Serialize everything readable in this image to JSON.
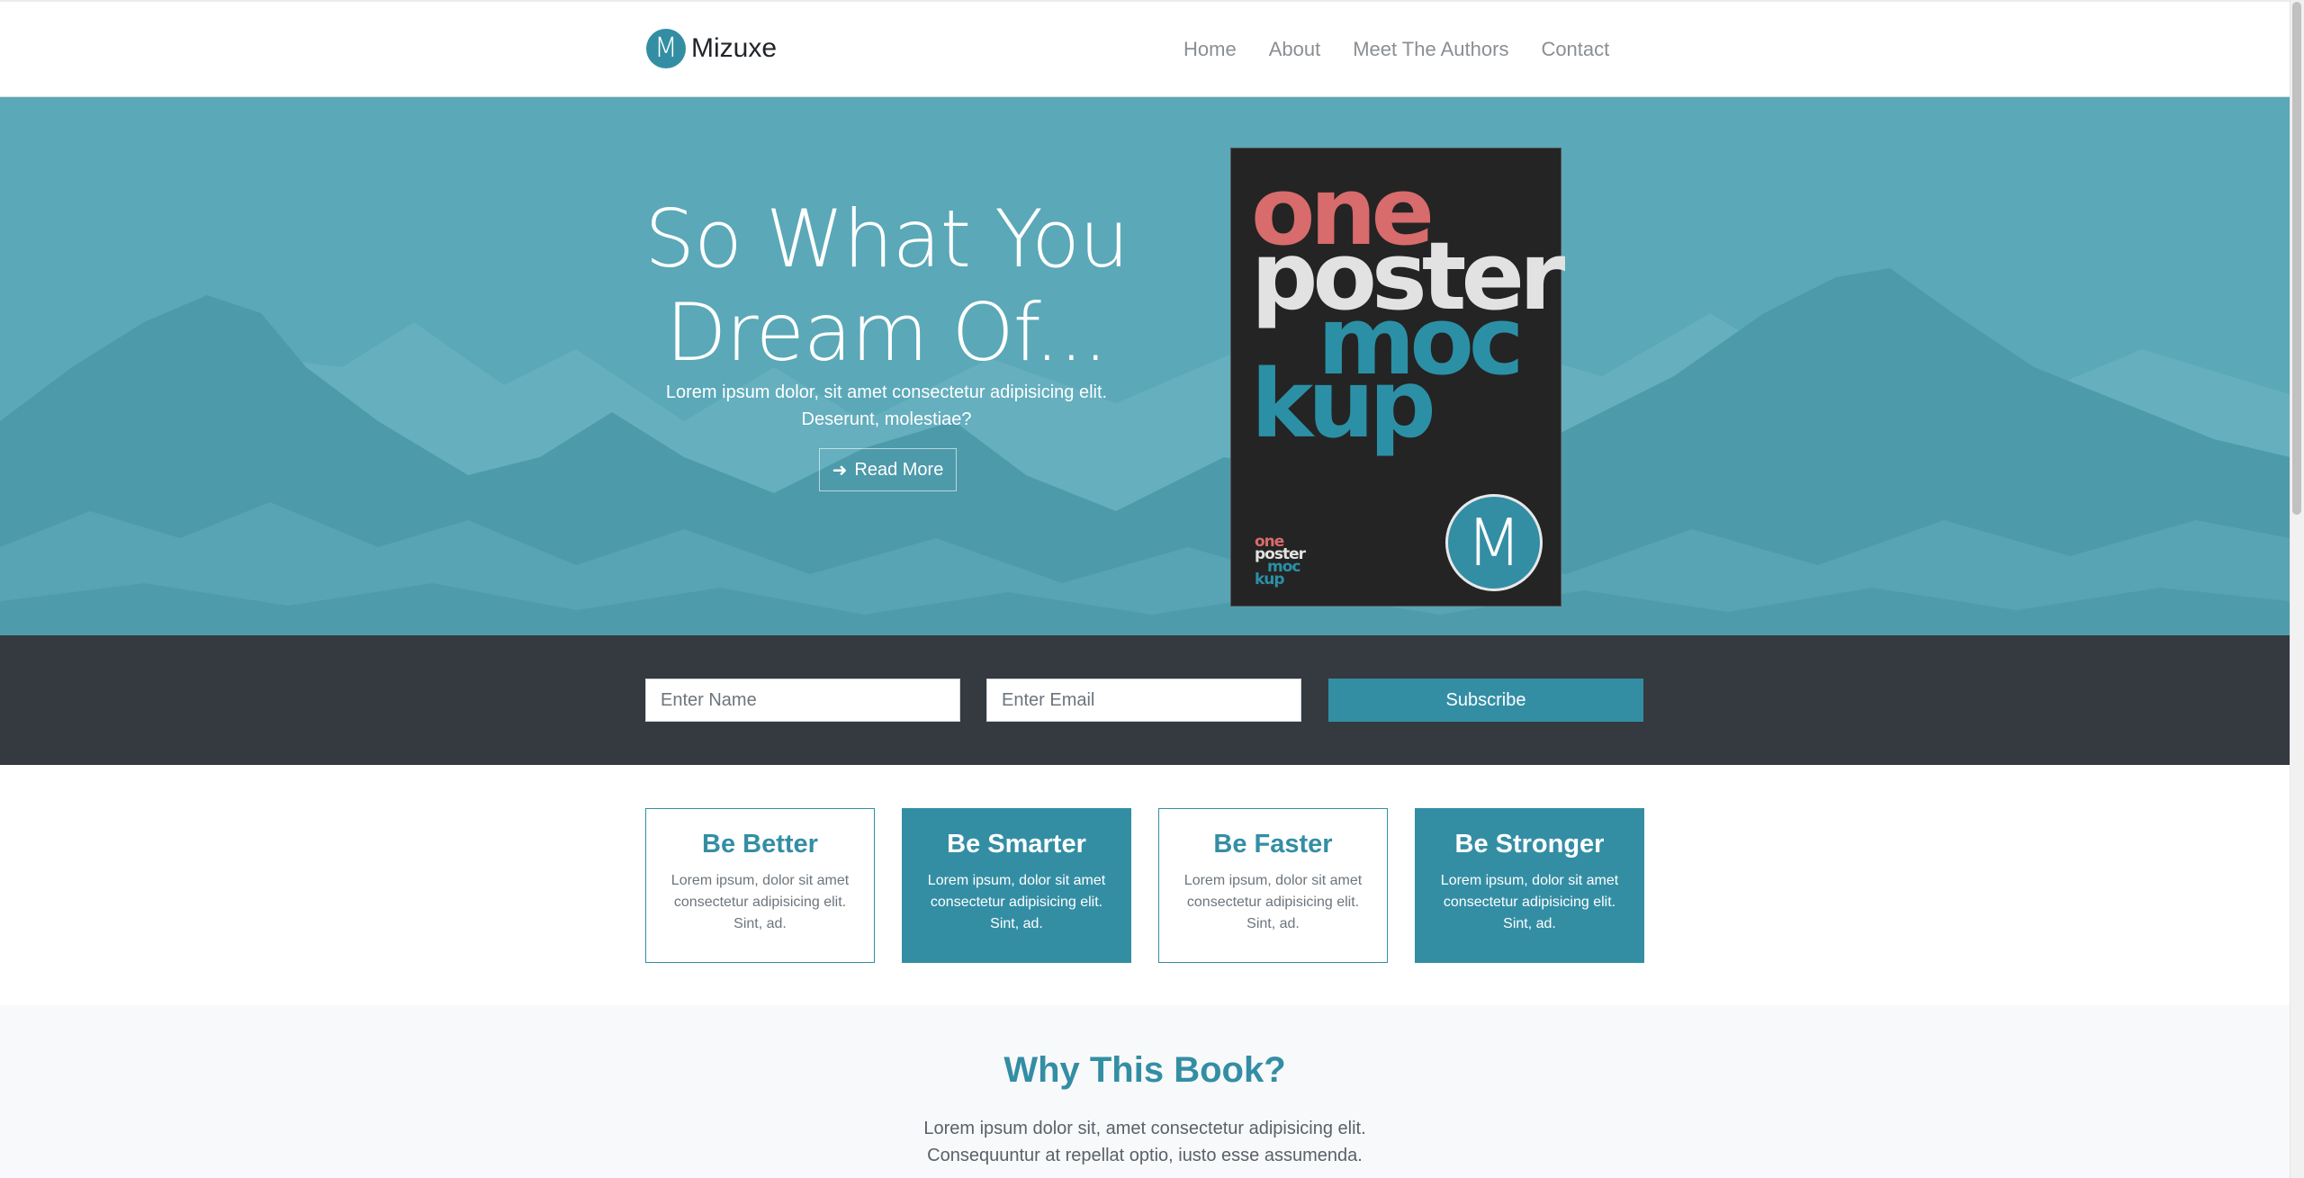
{
  "brand": {
    "logo_letter": "M",
    "name": "Mizuxe"
  },
  "nav": {
    "items": [
      {
        "label": "Home"
      },
      {
        "label": "About"
      },
      {
        "label": "Meet The Authors"
      },
      {
        "label": "Contact"
      }
    ]
  },
  "hero": {
    "title_line1": "So What You",
    "title_line2": "Dream Of...",
    "subtitle": "Lorem ipsum dolor, sit amet consectetur adipisicing elit. Deserunt, molestiae?",
    "button_label": "Read More",
    "button_icon": "arrow-right-icon"
  },
  "poster": {
    "word1": "one",
    "word2": "poster",
    "word3": "moc",
    "word4": "kup",
    "badge_letter": "M"
  },
  "subscribe": {
    "name_placeholder": "Enter Name",
    "email_placeholder": "Enter Email",
    "button_label": "Subscribe"
  },
  "features": [
    {
      "title": "Be Better",
      "text": "Lorem ipsum, dolor sit amet consectetur adipisicing elit. Sint, ad."
    },
    {
      "title": "Be Smarter",
      "text": "Lorem ipsum, dolor sit amet consectetur adipisicing elit. Sint, ad."
    },
    {
      "title": "Be Faster",
      "text": "Lorem ipsum, dolor sit amet consectetur adipisicing elit. Sint, ad."
    },
    {
      "title": "Be Stronger",
      "text": "Lorem ipsum, dolor sit amet consectetur adipisicing elit. Sint, ad."
    }
  ],
  "why": {
    "title": "Why This Book?",
    "text": "Lorem ipsum dolor sit, amet consectetur adipisicing elit. Consequuntur at repellat optio, iusto esse assumenda."
  },
  "colors": {
    "primary": "#338ea4",
    "hero_bg": "#5aa8b8",
    "dark": "#343a40",
    "light": "#f8f9fa",
    "poster_bg": "#242424",
    "poster_red": "#d86b6b"
  }
}
